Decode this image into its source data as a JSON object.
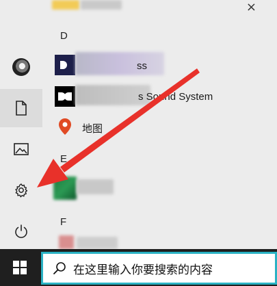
{
  "start_menu": {
    "close_symbol": "×",
    "sections": [
      {
        "letter": "D",
        "apps": [
          {
            "label": "ss",
            "icon": "dolby-dark-icon"
          },
          {
            "label": "s Sound System",
            "icon": "dolby-logo-icon"
          },
          {
            "label": "地图",
            "icon": "maps-pin-icon"
          }
        ]
      },
      {
        "letter": "E",
        "apps": [
          {
            "label": "",
            "icon": "green-app-icon"
          }
        ]
      },
      {
        "letter": "F",
        "apps": [
          {
            "label": "",
            "icon": "red-app-icon"
          }
        ]
      }
    ]
  },
  "rail": {
    "items": [
      {
        "name": "user-account",
        "icon": "avatar"
      },
      {
        "name": "documents",
        "icon": "document-icon"
      },
      {
        "name": "pictures",
        "icon": "picture-icon"
      },
      {
        "name": "settings",
        "icon": "gear-icon"
      },
      {
        "name": "power",
        "icon": "power-icon"
      }
    ]
  },
  "taskbar": {
    "search_placeholder": "在这里输入你要搜索的内容"
  },
  "colors": {
    "arrow": "#e8312a",
    "search_border": "#2ab2c4",
    "maps_pin": "#e04a24",
    "taskbar": "#1f1f1f"
  }
}
